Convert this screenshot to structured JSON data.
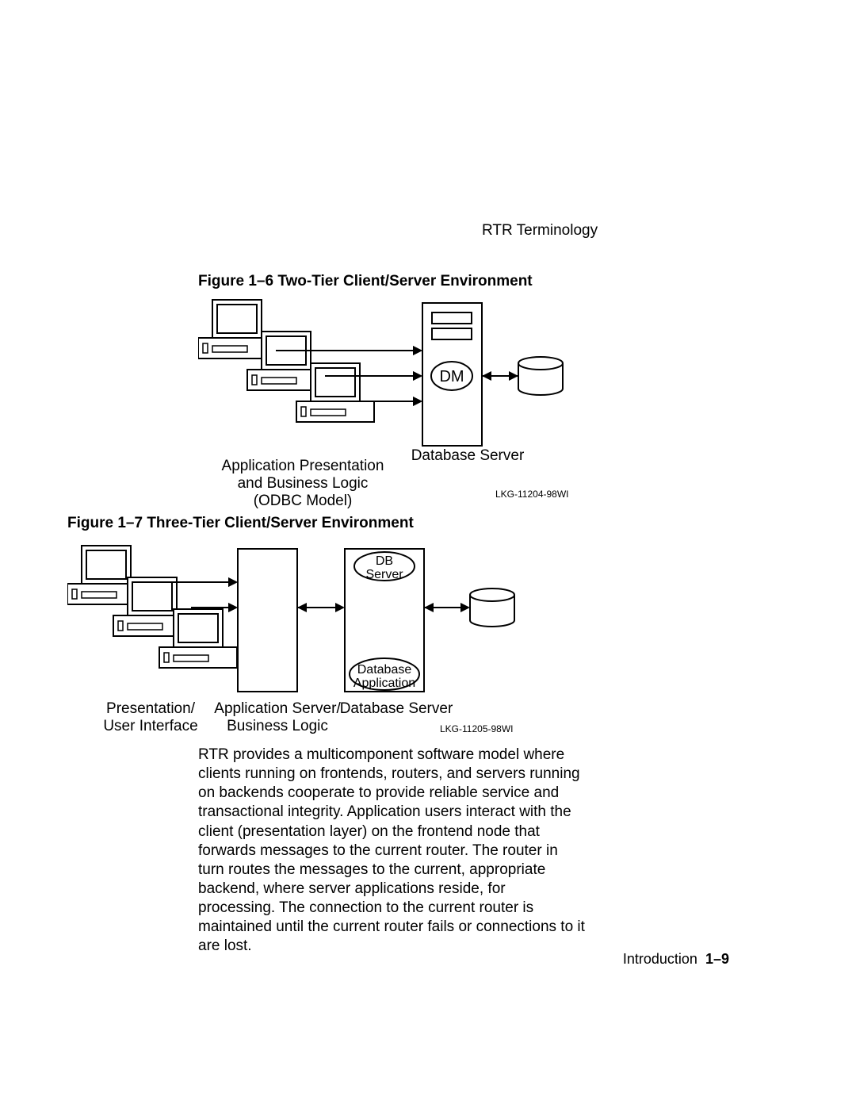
{
  "header": {
    "terminology": "RTR Terminology"
  },
  "figures": {
    "f16": {
      "caption": "Figure 1–6   Two-Tier Client/Server Environment"
    },
    "f17": {
      "caption": "Figure 1–7   Three-Tier Client/Server Environment"
    }
  },
  "diagram1": {
    "dm": "DM",
    "dbserver": "Database Server",
    "client_label_l1": "Application Presentation",
    "client_label_l2": "and Business Logic",
    "client_label_l3": "(ODBC Model)",
    "lkg": "LKG-11204-98WI"
  },
  "diagram2": {
    "dbserver_box_l1": "DB",
    "dbserver_box_l2": "Server",
    "dbapp_box_l1": "Database",
    "dbapp_box_l2": "Application",
    "present_l1": "Presentation/",
    "present_l2": "User Interface",
    "appserver_l1": "Application Server/",
    "appserver_l2": "Business Logic",
    "dbserver_label": "Database Server",
    "lkg": "LKG-11205-98WI"
  },
  "body_text": "RTR provides a multicomponent software model where clients running on frontends, routers, and servers running on backends cooperate to provide reliable service and transactional integrity. Application users interact with the client (presentation layer) on the frontend node that forwards messages to the current router.  The router in turn routes the messages to the current, appropriate backend, where server applications reside, for processing.  The connection to the current router is maintained until the current router fails or connections to it are lost.",
  "footer": {
    "intro": "Introduction",
    "page": "1–9"
  }
}
